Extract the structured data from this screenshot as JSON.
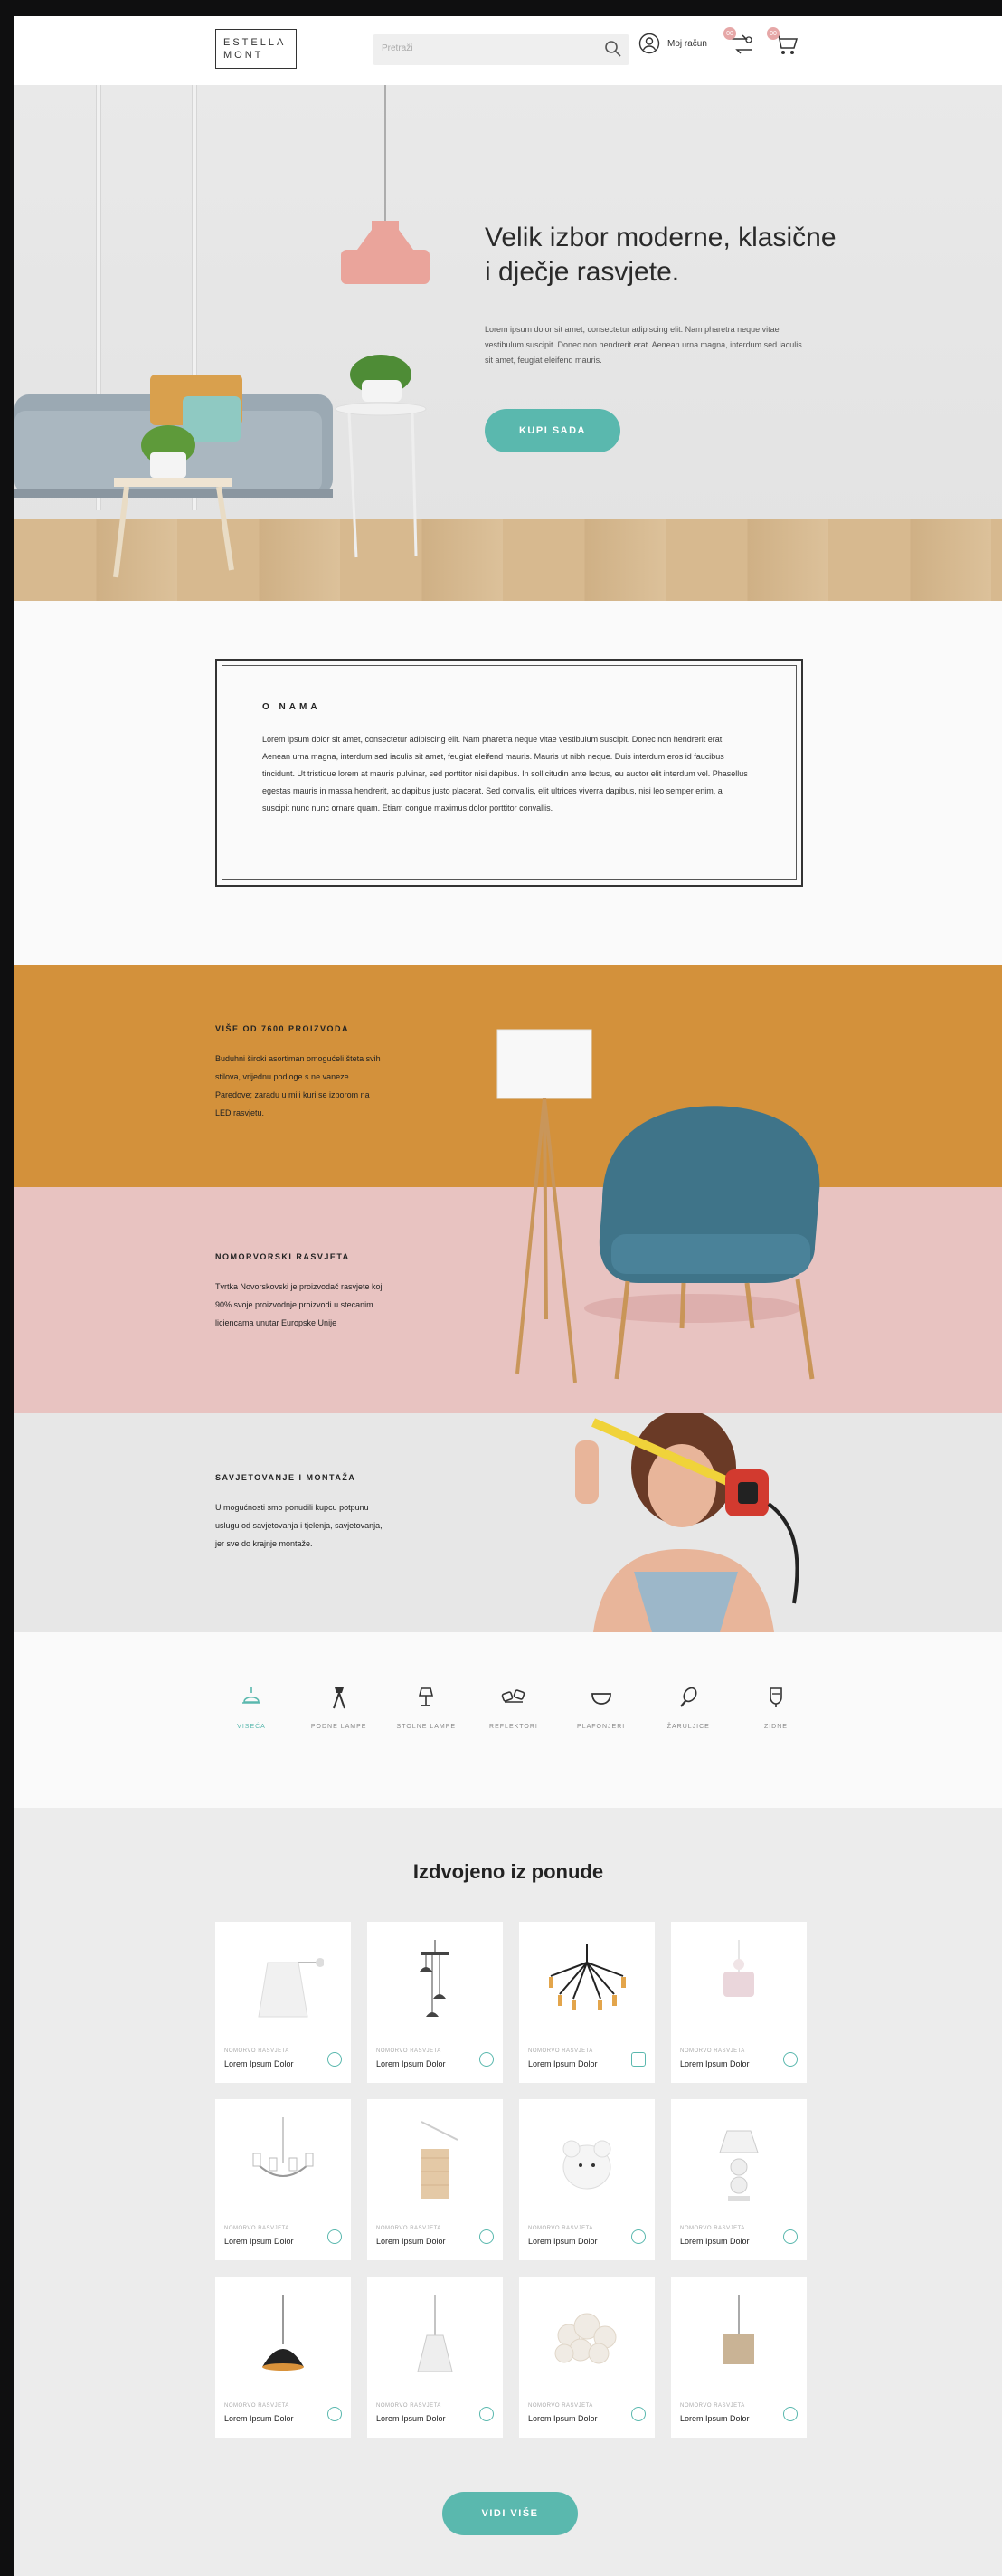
{
  "brand": {
    "logo_line1": "ESTELLA",
    "logo_line2": "MONT"
  },
  "header": {
    "search_placeholder": "Pretraži",
    "account_label": "Moj račun",
    "compare_badge": "00",
    "cart_badge": "00"
  },
  "hero": {
    "title": "Velik izbor moderne, klasične i dječje rasvjete.",
    "text": "Lorem ipsum dolor sit amet, consectetur adipiscing elit. Nam pharetra neque vitae vestibulum suscipit. Donec non hendrerit erat. Aenean urna magna, interdum sed iaculis sit amet, feugiat eleifend mauris.",
    "cta": "KUPI SADA"
  },
  "about": {
    "title": "O NAMA",
    "text": "Lorem ipsum dolor sit amet, consectetur adipiscing elit. Nam pharetra neque vitae vestibulum suscipit. Donec non hendrerit erat. Aenean urna magna, interdum sed iaculis sit amet, feugiat eleifend mauris. Mauris ut nibh neque. Duis interdum eros id faucibus tincidunt. Ut tristique lorem at mauris pulvinar, sed porttitor nisi dapibus. In sollicitudin ante lectus, eu auctor elit interdum vel. Phasellus egestas mauris in massa hendrerit, ac dapibus justo placerat. Sed convallis, elit ultrices viverra dapibus, nisi leo semper enim, a suscipit nunc nunc ornare quam. Etiam congue maximus dolor porttitor convallis."
  },
  "features": [
    {
      "title": "VIŠE OD 7600 PROIZVODA",
      "text": "Buduhni široki asortiman omogućeli šteta svih stilova, vrijednu podloge s ne vaneze Paredove; zaradu u mili kuri se izborom na LED rasvjetu."
    },
    {
      "title": "NOMORVORSKI RASVJETA",
      "text": "Tvrtka Novorskovski je proizvodač rasvjete koji 90% svoje proizvodnje proizvodi u stecanim liciencama unutar Europske Unije"
    },
    {
      "title": "SAVJETOVANJE I MONTAŽA",
      "text": "U mogućnosti smo ponudili kupcu potpunu uslugu od savjetovanja i tjelenja, savjetovanja, jer sve do krajnje montaže."
    }
  ],
  "categories": [
    {
      "label": "VISEĆA",
      "icon": "pendant-lamp-icon",
      "active": true
    },
    {
      "label": "PODNE LAMPE",
      "icon": "floor-lamp-icon"
    },
    {
      "label": "STOLNE LAMPE",
      "icon": "table-lamp-icon"
    },
    {
      "label": "REFLEKTORI",
      "icon": "spotlight-icon"
    },
    {
      "label": "PLAFONJERI",
      "icon": "ceiling-light-icon"
    },
    {
      "label": "ŽARULJICE",
      "icon": "bulb-icon"
    },
    {
      "label": "ZIDNE",
      "icon": "wall-lamp-icon"
    }
  ],
  "products": {
    "title": "Izdvojeno iz ponude",
    "brand_label": "NOMORVO RASVJETA",
    "item_name": "Lorem Ipsum Dolor",
    "more": "VIDI VIŠE"
  },
  "colors": {
    "accent": "#5ab8ae",
    "mustard": "#d3913b",
    "pink": "#e8c3c1",
    "grey": "#e8e8e8"
  }
}
